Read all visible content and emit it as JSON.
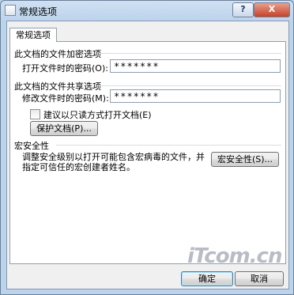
{
  "window": {
    "title": "常规选项",
    "help_label": "?",
    "close_label": "X"
  },
  "tabs": [
    {
      "label": "常规选项"
    }
  ],
  "encryption": {
    "heading": "此文档的文件加密选项",
    "open_password_label": "打开文件时的密码(O):",
    "open_password_value": "*******"
  },
  "sharing": {
    "heading": "此文档的文件共享选项",
    "modify_password_label": "修改文件时的密码(M):",
    "modify_password_value": "*******",
    "readonly_label": "建议以只读方式打开文档(E)",
    "readonly_checked": false,
    "protect_button": "保护文档(P)..."
  },
  "macro": {
    "heading": "宏安全性",
    "description_line1": "调整安全级别以打开可能包含宏病毒的文件，并",
    "description_line2": "指定可信任的宏创建者姓名。",
    "button": "宏安全性(S)..."
  },
  "footer": {
    "ok_label": "确定",
    "cancel_label": "取消"
  },
  "watermark": "iTcom.cn"
}
